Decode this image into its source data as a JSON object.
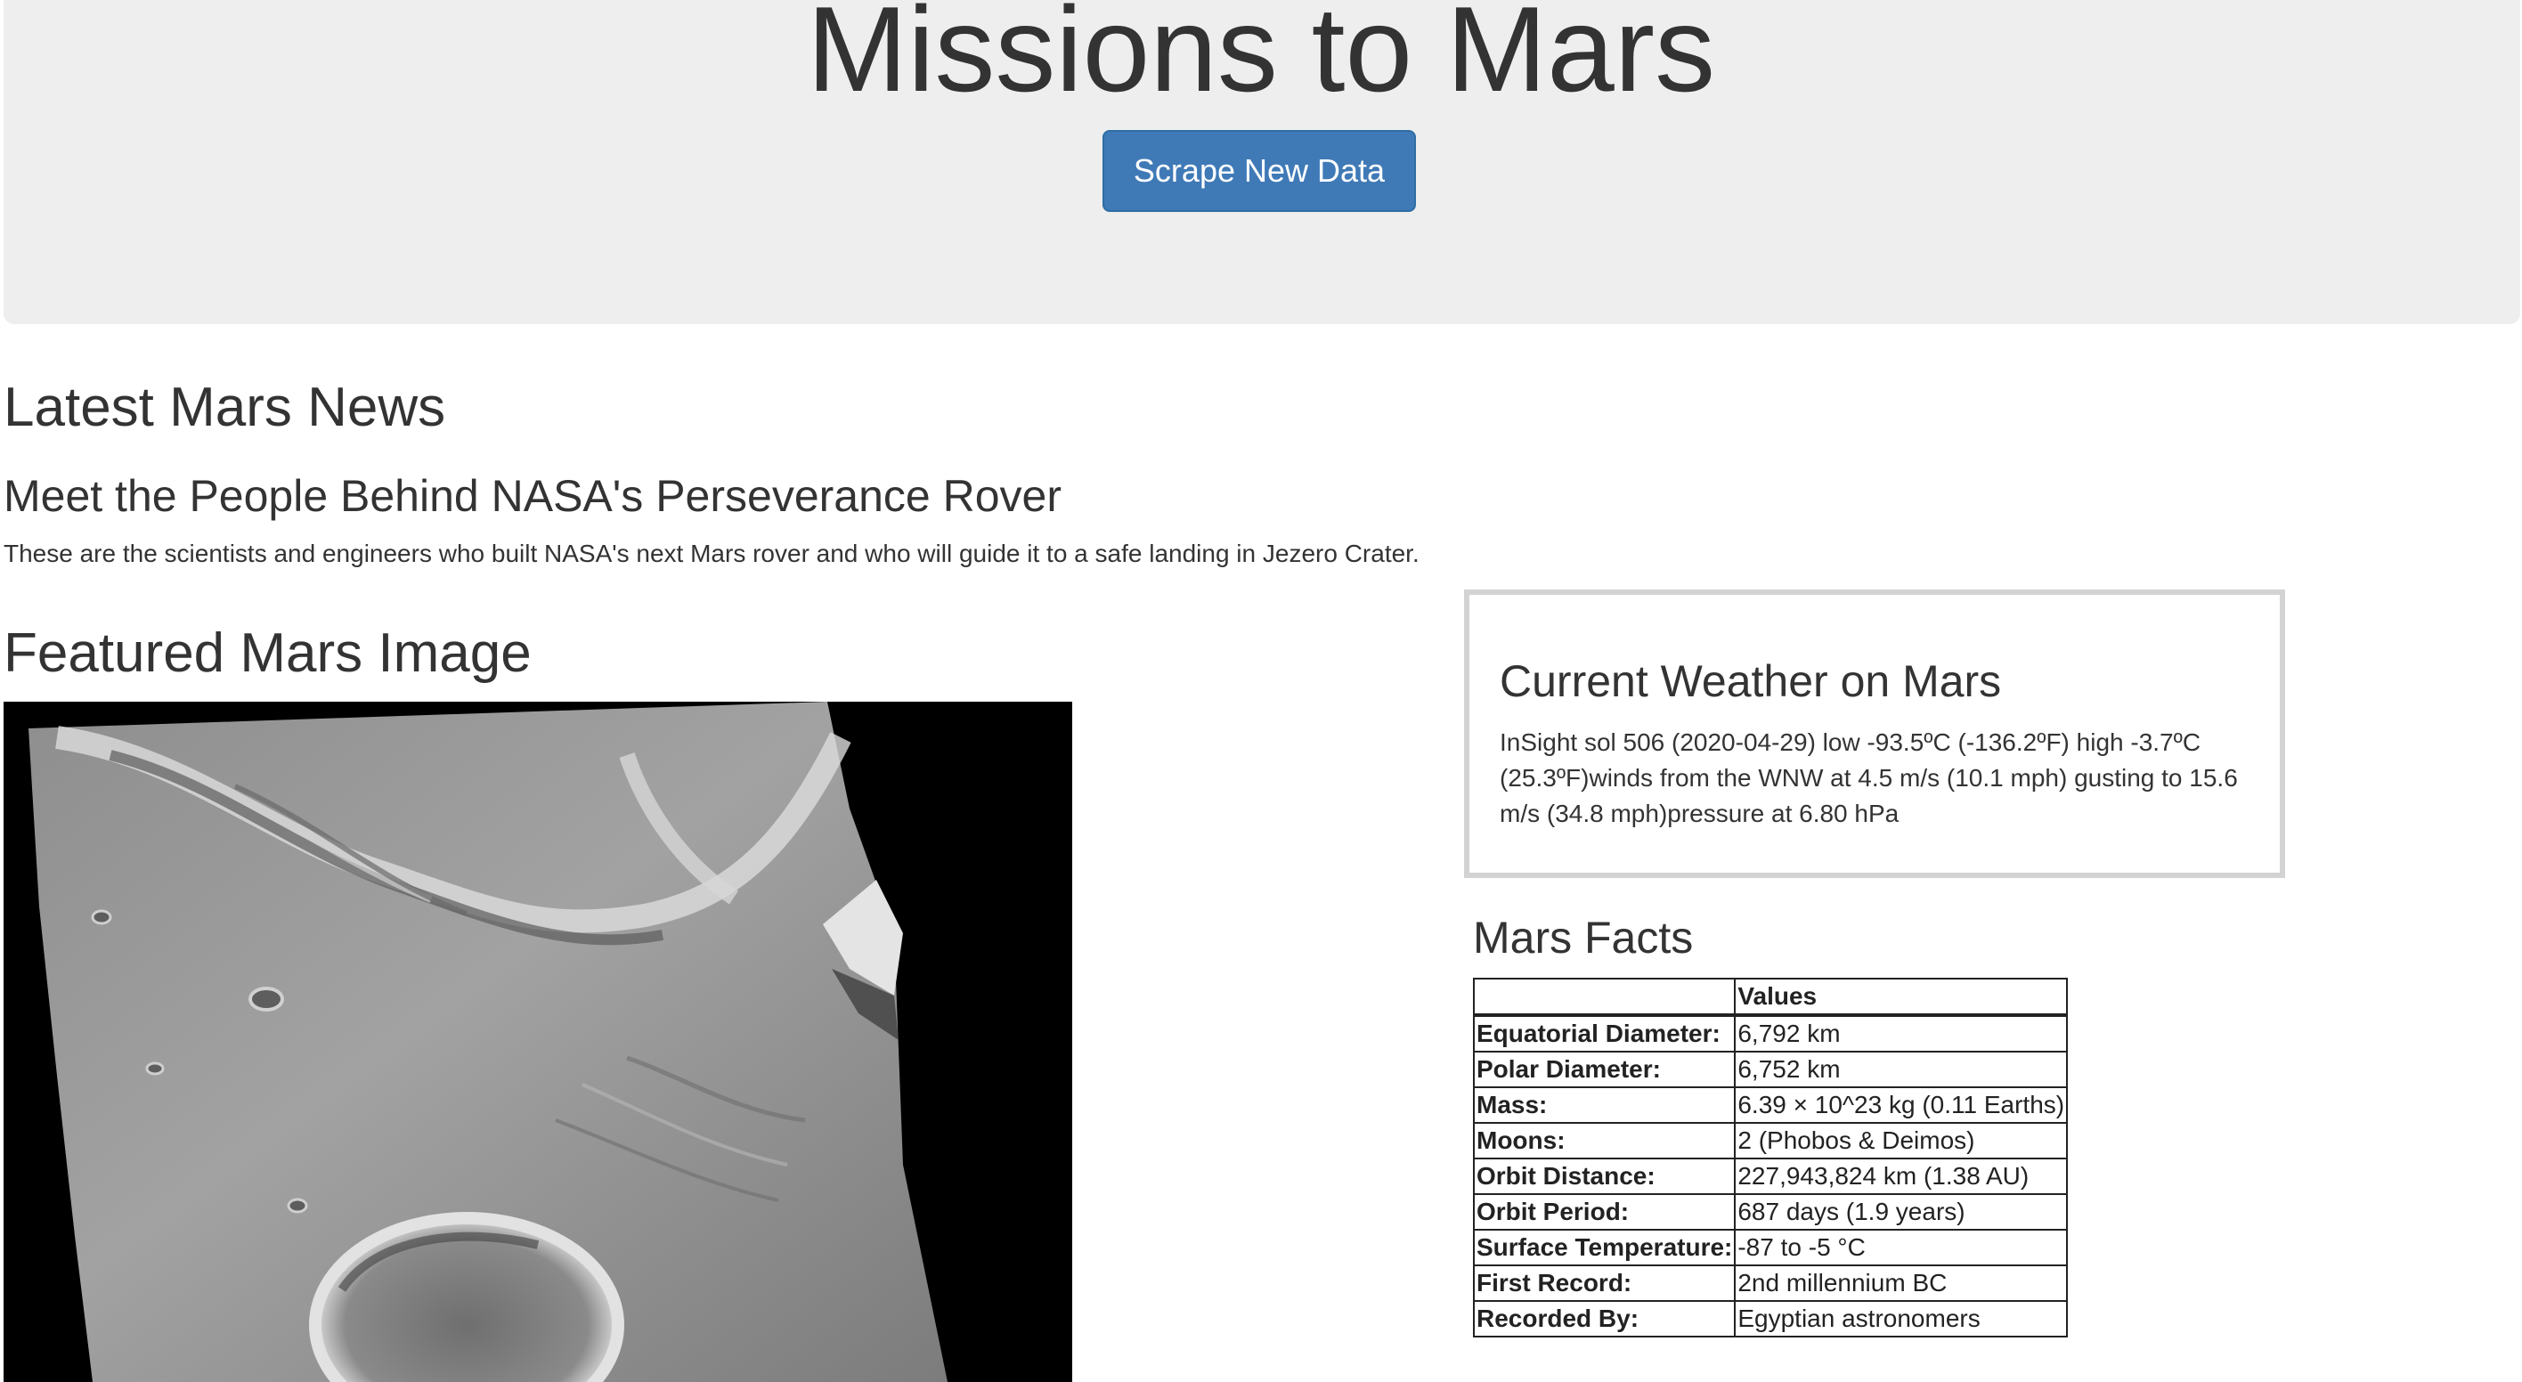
{
  "header": {
    "title": "Missions to Mars",
    "scrape_button_label": "Scrape New Data"
  },
  "news": {
    "heading": "Latest Mars News",
    "title": "Meet the People Behind NASA's Perseverance Rover",
    "teaser": "These are the scientists and engineers who built NASA's next Mars rover and who will guide it to a safe landing in Jezero Crater."
  },
  "featured_image": {
    "heading": "Featured Mars Image",
    "alt": "Grayscale orbital image of the Martian surface with channels and a crater"
  },
  "weather": {
    "heading": "Current Weather on Mars",
    "text": "InSight sol 506 (2020-04-29) low -93.5ºC (-136.2ºF) high -3.7ºC (25.3ºF)winds from the WNW at 4.5 m/s (10.1 mph) gusting to 15.6 m/s (34.8 mph)pressure at 6.80 hPa"
  },
  "facts": {
    "heading": "Mars Facts",
    "columns": [
      "",
      "Values"
    ],
    "rows": [
      {
        "label": "Equatorial Diameter:",
        "value": "6,792 km"
      },
      {
        "label": "Polar Diameter:",
        "value": "6,752 km"
      },
      {
        "label": "Mass:",
        "value": "6.39 × 10^23 kg (0.11 Earths)"
      },
      {
        "label": "Moons:",
        "value": "2 (Phobos & Deimos)"
      },
      {
        "label": "Orbit Distance:",
        "value": "227,943,824 km (1.38 AU)"
      },
      {
        "label": "Orbit Period:",
        "value": "687 days (1.9 years)"
      },
      {
        "label": "Surface Temperature:",
        "value": "-87 to -5 °C"
      },
      {
        "label": "First Record:",
        "value": "2nd millennium BC"
      },
      {
        "label": "Recorded By:",
        "value": "Egyptian astronomers"
      }
    ]
  },
  "colors": {
    "jumbotron_bg": "#eeeeee",
    "primary_button": "#3f7ab7",
    "text": "#333333",
    "weather_border": "#d3d3d3"
  }
}
